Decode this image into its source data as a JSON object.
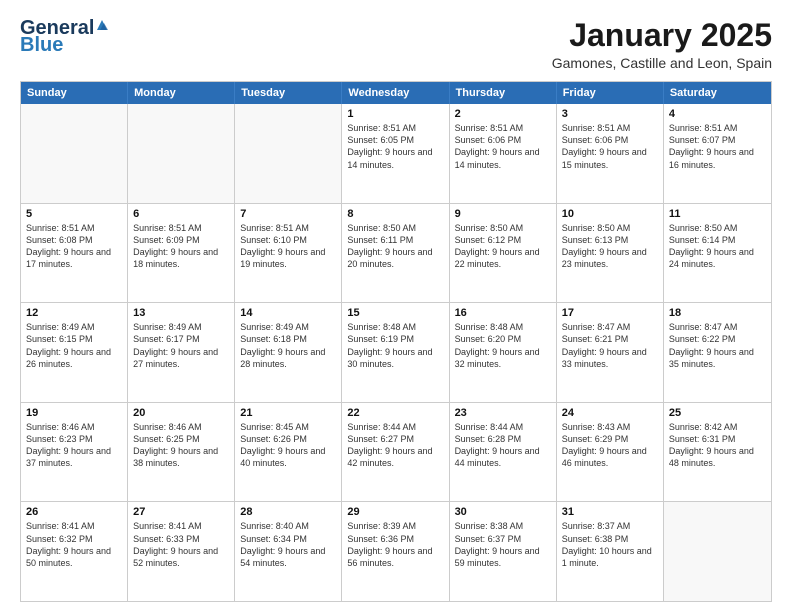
{
  "logo": {
    "general": "General",
    "blue": "Blue"
  },
  "title": {
    "month": "January 2025",
    "location": "Gamones, Castille and Leon, Spain"
  },
  "header_days": [
    "Sunday",
    "Monday",
    "Tuesday",
    "Wednesday",
    "Thursday",
    "Friday",
    "Saturday"
  ],
  "weeks": [
    [
      {
        "day": "",
        "sunrise": "",
        "sunset": "",
        "daylight": ""
      },
      {
        "day": "",
        "sunrise": "",
        "sunset": "",
        "daylight": ""
      },
      {
        "day": "",
        "sunrise": "",
        "sunset": "",
        "daylight": ""
      },
      {
        "day": "1",
        "sunrise": "Sunrise: 8:51 AM",
        "sunset": "Sunset: 6:05 PM",
        "daylight": "Daylight: 9 hours and 14 minutes."
      },
      {
        "day": "2",
        "sunrise": "Sunrise: 8:51 AM",
        "sunset": "Sunset: 6:06 PM",
        "daylight": "Daylight: 9 hours and 14 minutes."
      },
      {
        "day": "3",
        "sunrise": "Sunrise: 8:51 AM",
        "sunset": "Sunset: 6:06 PM",
        "daylight": "Daylight: 9 hours and 15 minutes."
      },
      {
        "day": "4",
        "sunrise": "Sunrise: 8:51 AM",
        "sunset": "Sunset: 6:07 PM",
        "daylight": "Daylight: 9 hours and 16 minutes."
      }
    ],
    [
      {
        "day": "5",
        "sunrise": "Sunrise: 8:51 AM",
        "sunset": "Sunset: 6:08 PM",
        "daylight": "Daylight: 9 hours and 17 minutes."
      },
      {
        "day": "6",
        "sunrise": "Sunrise: 8:51 AM",
        "sunset": "Sunset: 6:09 PM",
        "daylight": "Daylight: 9 hours and 18 minutes."
      },
      {
        "day": "7",
        "sunrise": "Sunrise: 8:51 AM",
        "sunset": "Sunset: 6:10 PM",
        "daylight": "Daylight: 9 hours and 19 minutes."
      },
      {
        "day": "8",
        "sunrise": "Sunrise: 8:50 AM",
        "sunset": "Sunset: 6:11 PM",
        "daylight": "Daylight: 9 hours and 20 minutes."
      },
      {
        "day": "9",
        "sunrise": "Sunrise: 8:50 AM",
        "sunset": "Sunset: 6:12 PM",
        "daylight": "Daylight: 9 hours and 22 minutes."
      },
      {
        "day": "10",
        "sunrise": "Sunrise: 8:50 AM",
        "sunset": "Sunset: 6:13 PM",
        "daylight": "Daylight: 9 hours and 23 minutes."
      },
      {
        "day": "11",
        "sunrise": "Sunrise: 8:50 AM",
        "sunset": "Sunset: 6:14 PM",
        "daylight": "Daylight: 9 hours and 24 minutes."
      }
    ],
    [
      {
        "day": "12",
        "sunrise": "Sunrise: 8:49 AM",
        "sunset": "Sunset: 6:15 PM",
        "daylight": "Daylight: 9 hours and 26 minutes."
      },
      {
        "day": "13",
        "sunrise": "Sunrise: 8:49 AM",
        "sunset": "Sunset: 6:17 PM",
        "daylight": "Daylight: 9 hours and 27 minutes."
      },
      {
        "day": "14",
        "sunrise": "Sunrise: 8:49 AM",
        "sunset": "Sunset: 6:18 PM",
        "daylight": "Daylight: 9 hours and 28 minutes."
      },
      {
        "day": "15",
        "sunrise": "Sunrise: 8:48 AM",
        "sunset": "Sunset: 6:19 PM",
        "daylight": "Daylight: 9 hours and 30 minutes."
      },
      {
        "day": "16",
        "sunrise": "Sunrise: 8:48 AM",
        "sunset": "Sunset: 6:20 PM",
        "daylight": "Daylight: 9 hours and 32 minutes."
      },
      {
        "day": "17",
        "sunrise": "Sunrise: 8:47 AM",
        "sunset": "Sunset: 6:21 PM",
        "daylight": "Daylight: 9 hours and 33 minutes."
      },
      {
        "day": "18",
        "sunrise": "Sunrise: 8:47 AM",
        "sunset": "Sunset: 6:22 PM",
        "daylight": "Daylight: 9 hours and 35 minutes."
      }
    ],
    [
      {
        "day": "19",
        "sunrise": "Sunrise: 8:46 AM",
        "sunset": "Sunset: 6:23 PM",
        "daylight": "Daylight: 9 hours and 37 minutes."
      },
      {
        "day": "20",
        "sunrise": "Sunrise: 8:46 AM",
        "sunset": "Sunset: 6:25 PM",
        "daylight": "Daylight: 9 hours and 38 minutes."
      },
      {
        "day": "21",
        "sunrise": "Sunrise: 8:45 AM",
        "sunset": "Sunset: 6:26 PM",
        "daylight": "Daylight: 9 hours and 40 minutes."
      },
      {
        "day": "22",
        "sunrise": "Sunrise: 8:44 AM",
        "sunset": "Sunset: 6:27 PM",
        "daylight": "Daylight: 9 hours and 42 minutes."
      },
      {
        "day": "23",
        "sunrise": "Sunrise: 8:44 AM",
        "sunset": "Sunset: 6:28 PM",
        "daylight": "Daylight: 9 hours and 44 minutes."
      },
      {
        "day": "24",
        "sunrise": "Sunrise: 8:43 AM",
        "sunset": "Sunset: 6:29 PM",
        "daylight": "Daylight: 9 hours and 46 minutes."
      },
      {
        "day": "25",
        "sunrise": "Sunrise: 8:42 AM",
        "sunset": "Sunset: 6:31 PM",
        "daylight": "Daylight: 9 hours and 48 minutes."
      }
    ],
    [
      {
        "day": "26",
        "sunrise": "Sunrise: 8:41 AM",
        "sunset": "Sunset: 6:32 PM",
        "daylight": "Daylight: 9 hours and 50 minutes."
      },
      {
        "day": "27",
        "sunrise": "Sunrise: 8:41 AM",
        "sunset": "Sunset: 6:33 PM",
        "daylight": "Daylight: 9 hours and 52 minutes."
      },
      {
        "day": "28",
        "sunrise": "Sunrise: 8:40 AM",
        "sunset": "Sunset: 6:34 PM",
        "daylight": "Daylight: 9 hours and 54 minutes."
      },
      {
        "day": "29",
        "sunrise": "Sunrise: 8:39 AM",
        "sunset": "Sunset: 6:36 PM",
        "daylight": "Daylight: 9 hours and 56 minutes."
      },
      {
        "day": "30",
        "sunrise": "Sunrise: 8:38 AM",
        "sunset": "Sunset: 6:37 PM",
        "daylight": "Daylight: 9 hours and 59 minutes."
      },
      {
        "day": "31",
        "sunrise": "Sunrise: 8:37 AM",
        "sunset": "Sunset: 6:38 PM",
        "daylight": "Daylight: 10 hours and 1 minute."
      },
      {
        "day": "",
        "sunrise": "",
        "sunset": "",
        "daylight": ""
      }
    ]
  ]
}
